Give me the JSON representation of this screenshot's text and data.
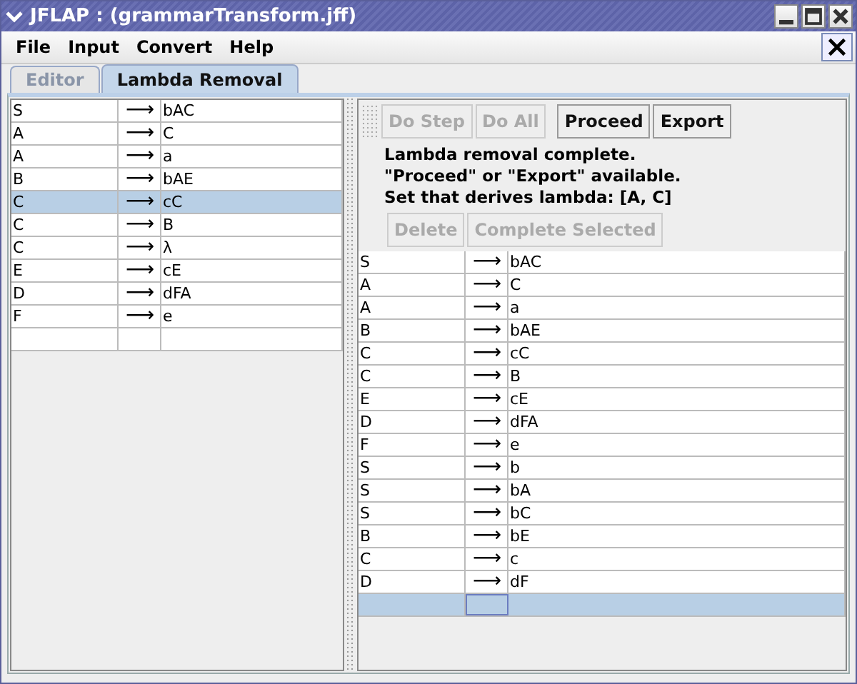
{
  "window": {
    "title": "JFLAP : (grammarTransform.jff)"
  },
  "menu": [
    "File",
    "Input",
    "Convert",
    "Help"
  ],
  "tabs": [
    {
      "label": "Editor",
      "selected": false
    },
    {
      "label": "Lambda Removal",
      "selected": true
    }
  ],
  "grammar": {
    "rows": [
      {
        "lhs": "S",
        "arrow": "⟶",
        "rhs": "bAC",
        "selected": false
      },
      {
        "lhs": "A",
        "arrow": "⟶",
        "rhs": "C",
        "selected": false
      },
      {
        "lhs": "A",
        "arrow": "⟶",
        "rhs": "a",
        "selected": false
      },
      {
        "lhs": "B",
        "arrow": "⟶",
        "rhs": "bAE",
        "selected": false
      },
      {
        "lhs": "C",
        "arrow": "⟶",
        "rhs": "cC",
        "selected": true
      },
      {
        "lhs": "C",
        "arrow": "⟶",
        "rhs": "B",
        "selected": false
      },
      {
        "lhs": "C",
        "arrow": "⟶",
        "rhs": "λ",
        "selected": false
      },
      {
        "lhs": "E",
        "arrow": "⟶",
        "rhs": "cE",
        "selected": false
      },
      {
        "lhs": "D",
        "arrow": "⟶",
        "rhs": "dFA",
        "selected": false
      },
      {
        "lhs": "F",
        "arrow": "⟶",
        "rhs": "e",
        "selected": false
      }
    ],
    "new_row": {
      "selected": false
    }
  },
  "toolbar": [
    {
      "label": "Do Step",
      "disabled": true
    },
    {
      "label": "Do All",
      "disabled": true
    },
    {
      "label": "Proceed",
      "disabled": false
    },
    {
      "label": "Export",
      "disabled": false
    }
  ],
  "messages": [
    "Lambda removal complete.",
    "\"Proceed\" or \"Export\" available.",
    "Set that derives lambda: [A, C]"
  ],
  "edit_buttons": [
    {
      "label": "Delete",
      "disabled": true
    },
    {
      "label": "Complete Selected",
      "disabled": true
    }
  ],
  "result": {
    "rows": [
      {
        "lhs": "S",
        "arrow": "⟶",
        "rhs": "bAC",
        "selected": false
      },
      {
        "lhs": "A",
        "arrow": "⟶",
        "rhs": "C",
        "selected": false
      },
      {
        "lhs": "A",
        "arrow": "⟶",
        "rhs": "a",
        "selected": false
      },
      {
        "lhs": "B",
        "arrow": "⟶",
        "rhs": "bAE",
        "selected": false
      },
      {
        "lhs": "C",
        "arrow": "⟶",
        "rhs": "cC",
        "selected": false
      },
      {
        "lhs": "C",
        "arrow": "⟶",
        "rhs": "B",
        "selected": false
      },
      {
        "lhs": "E",
        "arrow": "⟶",
        "rhs": "cE",
        "selected": false
      },
      {
        "lhs": "D",
        "arrow": "⟶",
        "rhs": "dFA",
        "selected": false
      },
      {
        "lhs": "F",
        "arrow": "⟶",
        "rhs": "e",
        "selected": false
      },
      {
        "lhs": "S",
        "arrow": "⟶",
        "rhs": "b",
        "selected": false
      },
      {
        "lhs": "S",
        "arrow": "⟶",
        "rhs": "bA",
        "selected": false
      },
      {
        "lhs": "S",
        "arrow": "⟶",
        "rhs": "bC",
        "selected": false
      },
      {
        "lhs": "B",
        "arrow": "⟶",
        "rhs": "bE",
        "selected": false
      },
      {
        "lhs": "C",
        "arrow": "⟶",
        "rhs": "c",
        "selected": false
      },
      {
        "lhs": "D",
        "arrow": "⟶",
        "rhs": "dF",
        "selected": false
      }
    ],
    "new_row": {
      "selected": true
    }
  }
}
